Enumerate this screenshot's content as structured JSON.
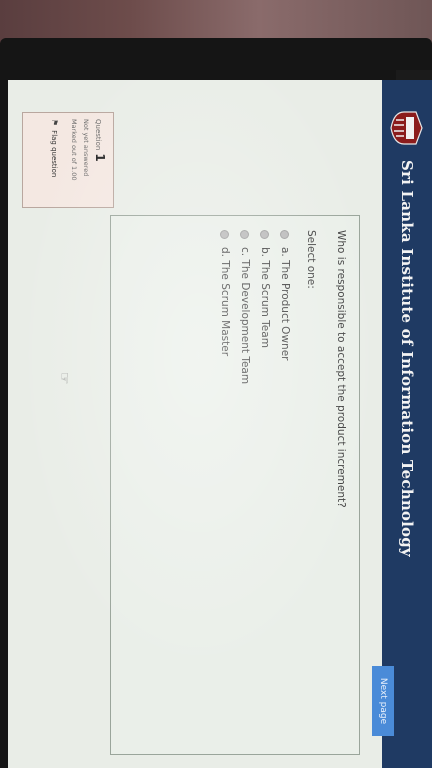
{
  "header": {
    "institute_name": "Sri Lanka Institute of Information Technology",
    "logo_text": "SLIIT"
  },
  "info": {
    "question_label": "Question",
    "question_number": "1",
    "status": "Not yet answered",
    "marks": "Marked out of 1.00",
    "flag_label": "Flag question"
  },
  "question": {
    "text": "Who is responsible to accept the product increment?",
    "prompt": "Select one:",
    "options": [
      "a. The Product Owner",
      "b. The Scrum Team",
      "c. The Development Team",
      "d. The Scrum Master"
    ]
  },
  "navigation": {
    "next_label": "Next page"
  },
  "colors": {
    "header": "#1f3a63",
    "next_button": "#4a8bd8",
    "info_box": "#f4e8e2"
  }
}
